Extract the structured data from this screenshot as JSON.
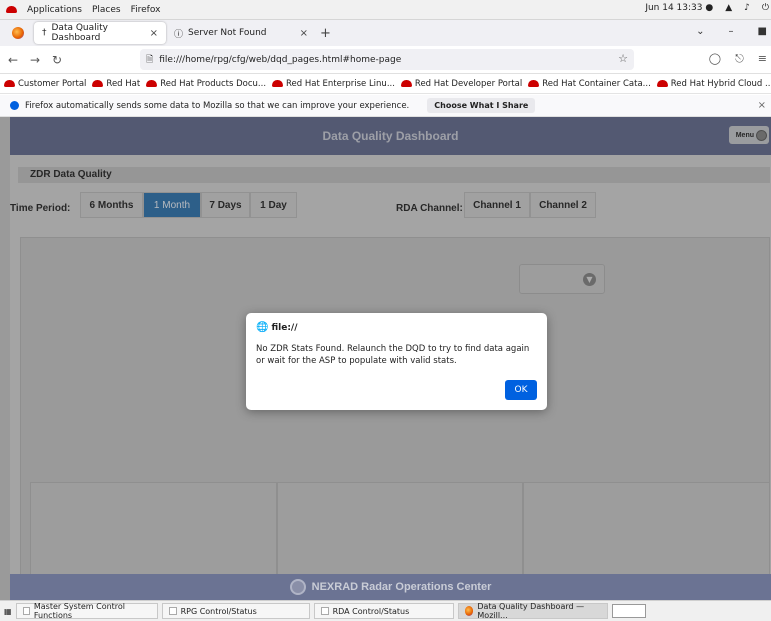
{
  "gnome": {
    "applications": "Applications",
    "places": "Places",
    "firefox": "Firefox",
    "clock": "Jun 14  13:33 ●"
  },
  "tabs": [
    {
      "label": "Data Quality Dashboard"
    },
    {
      "label": "Server Not Found"
    }
  ],
  "nav": {
    "url": "file:///home/rpg/cfg/web/dqd_pages.html#home-page"
  },
  "bookmarks": [
    "Customer Portal",
    "Red Hat",
    "Red Hat Products Docu...",
    "Red Hat Enterprise Linu...",
    "Red Hat Developer Portal",
    "Red Hat Container Cata...",
    "Red Hat Hybrid Cloud ..."
  ],
  "notice": {
    "text": "Firefox automatically sends some data to Mozilla so that we can improve your experience.",
    "button": "Choose What I Share"
  },
  "dashboard": {
    "title": "Data Quality Dashboard",
    "menu": "Menu",
    "section": "ZDR Data Quality",
    "time_period_label": "Time Period:",
    "time_options": [
      "6 Months",
      "1 Month",
      "7 Days",
      "1 Day"
    ],
    "time_selected": "1 Month",
    "rda_label": "RDA Channel:",
    "channels": [
      "Channel 1",
      "Channel 2"
    ],
    "footer": "NEXRAD Radar Operations Center"
  },
  "dialog": {
    "title": "file://",
    "message": "No ZDR Stats Found. Relaunch the DQD to try to find data again or wait for the ASP to populate with valid stats.",
    "ok": "OK"
  },
  "taskbar": [
    "Master System Control Functions",
    "RPG Control/Status",
    "RDA Control/Status",
    "Data Quality Dashboard — Mozill..."
  ],
  "colors": {
    "header": "#6b7393",
    "active_segment": "#3a7ab0",
    "ok_button": "#0061e0"
  }
}
